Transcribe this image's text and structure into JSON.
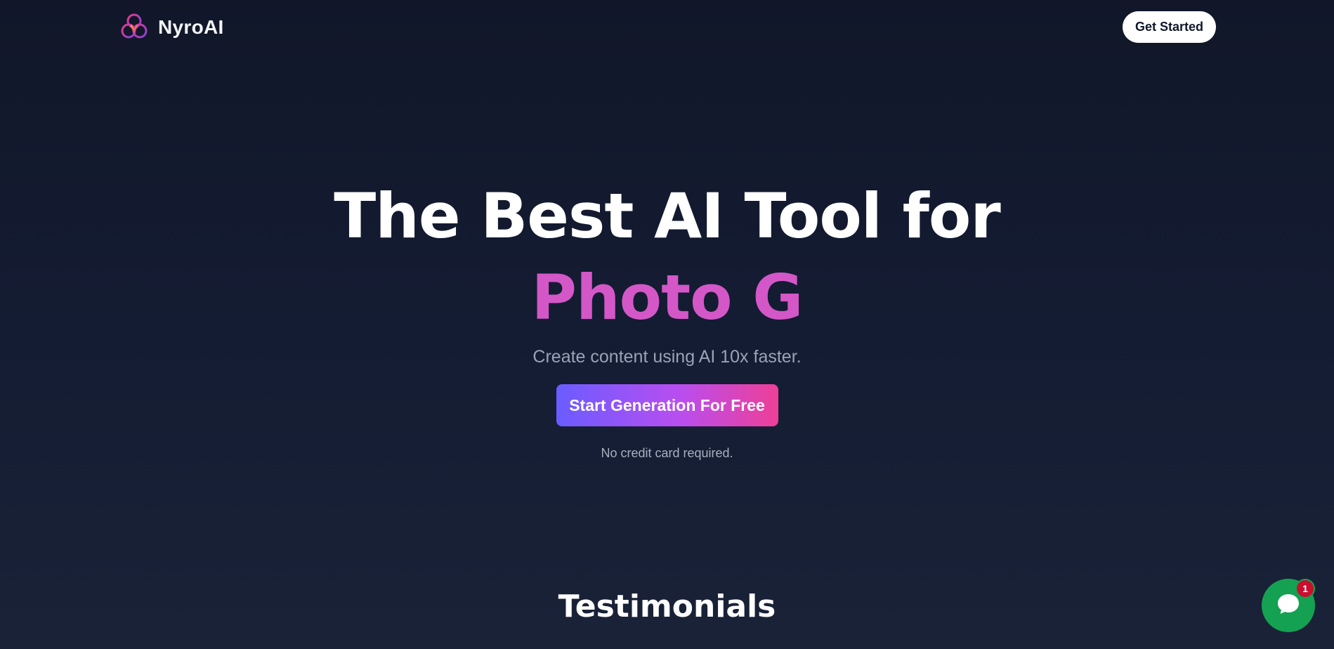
{
  "brand": {
    "name": "NyroAI",
    "logo_icon": "triple-ring-logo-icon"
  },
  "nav": {
    "cta_label": "Get Started"
  },
  "hero": {
    "title_line1": "The Best AI Tool for",
    "title_line2": "Photo G",
    "subtitle": "Create content using AI 10x faster.",
    "cta_label": "Start Generation For Free",
    "note": "No credit card required."
  },
  "sections": {
    "testimonials_heading": "Testimonials"
  },
  "chat": {
    "icon": "chat-bubble-icon",
    "badge_count": "1"
  },
  "colors": {
    "background": "#111729",
    "accent_pink": "#d457c8",
    "cta_gradient_start": "#6a5cff",
    "cta_gradient_end": "#ee3f97",
    "chat_green": "#14a152",
    "badge_red": "#c8102e"
  }
}
